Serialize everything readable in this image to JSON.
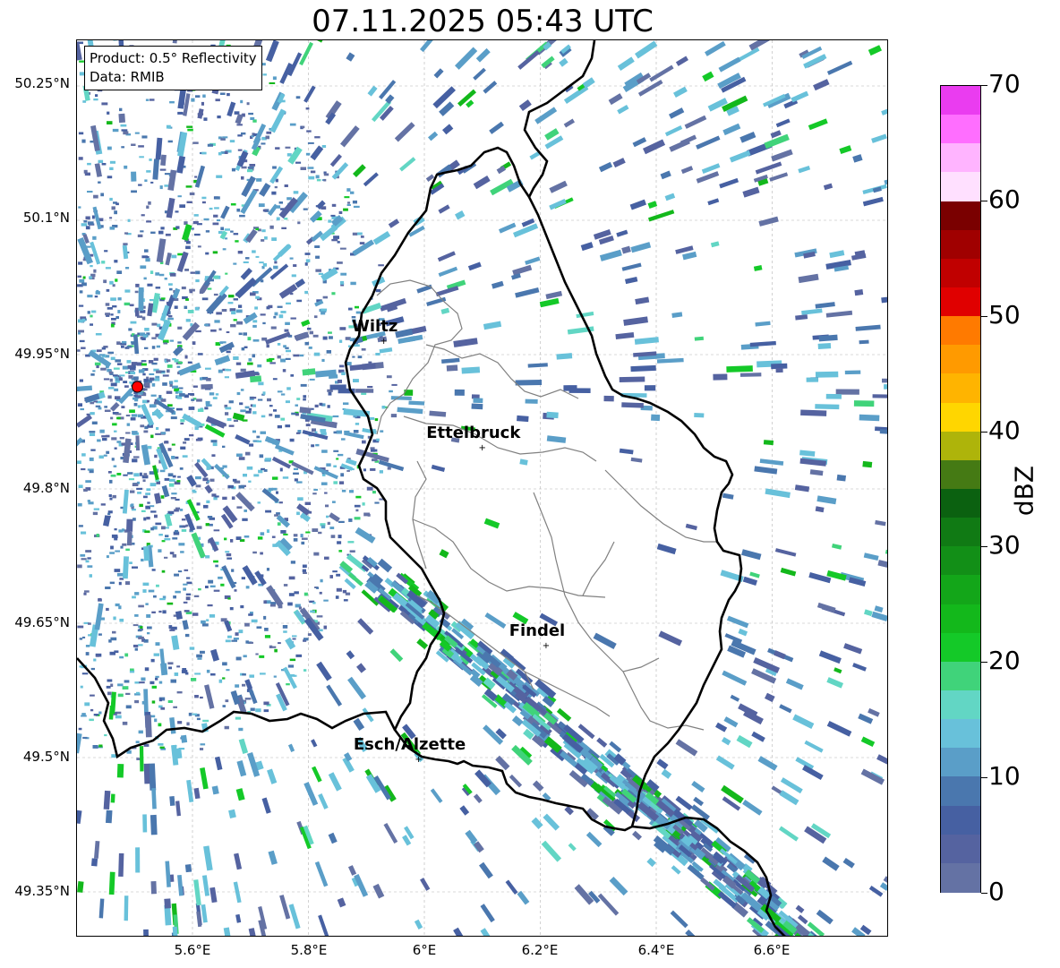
{
  "title": "07.11.2025 05:43 UTC",
  "info_box": {
    "product": "Product: 0.5° Reflectivity",
    "data_source": "Data: RMIB"
  },
  "axes": {
    "lat_ticks": [
      "50.25°N",
      "50.1°N",
      "49.95°N",
      "49.8°N",
      "49.65°N",
      "49.5°N",
      "49.35°N"
    ],
    "lon_ticks": [
      "5.6°E",
      "5.8°E",
      "6°E",
      "6.2°E",
      "6.4°E",
      "6.6°E"
    ]
  },
  "cities": [
    {
      "name": "Wiltz",
      "lon": 5.93,
      "lat": 49.966
    },
    {
      "name": "Ettelbruck",
      "lon": 6.1,
      "lat": 49.847
    },
    {
      "name": "Findel",
      "lon": 6.21,
      "lat": 49.626
    },
    {
      "name": "Esch/Alzette",
      "lon": 5.99,
      "lat": 49.499
    }
  ],
  "radar_site": {
    "lon": 5.505,
    "lat": 49.914,
    "color": "#ff0000"
  },
  "colorbar": {
    "label": "dBZ",
    "min": 0,
    "max": 70,
    "ticks": [
      "0",
      "10",
      "20",
      "30",
      "40",
      "50",
      "60",
      "70"
    ],
    "colors": [
      "#6472a4",
      "#5563a0",
      "#4660a2",
      "#4a77ae",
      "#5a9ec8",
      "#68c1da",
      "#62d6c4",
      "#40d37a",
      "#14c928",
      "#13b81b",
      "#13a619",
      "#128f17",
      "#107a14",
      "#0b6110",
      "#457a14",
      "#aeb40a",
      "#ffd600",
      "#ffb400",
      "#ff9a00",
      "#ff7a00",
      "#e00000",
      "#c00000",
      "#a00000",
      "#7a0000",
      "#ffe0ff",
      "#ffb4ff",
      "#ff6eff",
      "#ea3cf0"
    ]
  },
  "map_colors": {
    "border": "#000000",
    "cantons": "#808080",
    "grid": "#b4b4b4"
  }
}
